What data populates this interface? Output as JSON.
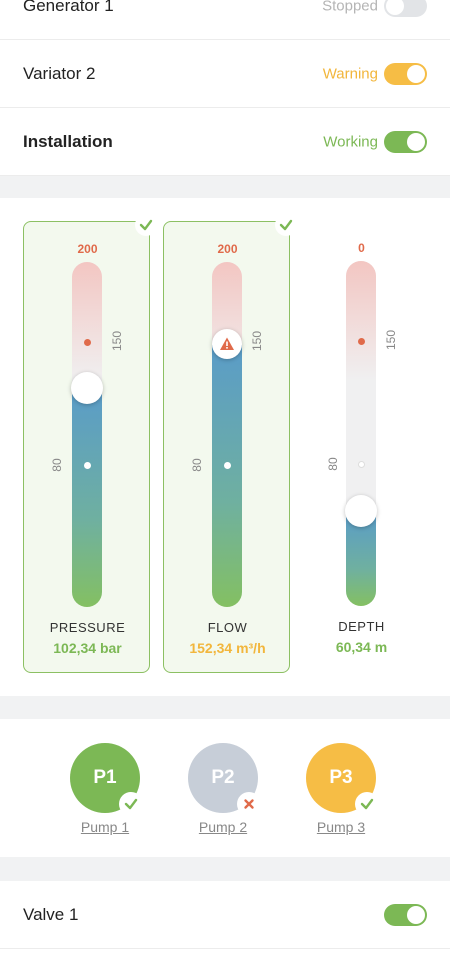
{
  "rows_top": [
    {
      "name": "Generator 1",
      "status": "Stopped",
      "status_color": "#b5b5b5",
      "toggle_on": false,
      "bold": false
    },
    {
      "name": "Variator 2",
      "status": "Warning",
      "status_color": "#f2b63c",
      "toggle_on": true,
      "toggle_color": "#f6bd45",
      "bold": false
    },
    {
      "name": "Installation",
      "status": "Working",
      "status_color": "#7cb855",
      "toggle_on": true,
      "toggle_color": "#7cb855",
      "bold": true
    }
  ],
  "gauges": [
    {
      "name": "PRESSURE",
      "value": "102,34 bar",
      "value_color": "#7cb855",
      "top": "200",
      "mid": "150",
      "low": "80",
      "level_pct": 63,
      "active": true,
      "marker": "knob"
    },
    {
      "name": "FLOW",
      "value": "152,34 m³/h",
      "value_color": "#f2b63c",
      "top": "200",
      "mid": "150",
      "low": "80",
      "level_pct": 76,
      "active": true,
      "marker": "warning"
    },
    {
      "name": "DEPTH",
      "value": "60,34 m",
      "value_color": "#7cb855",
      "top": "0",
      "mid": "150",
      "low": "80",
      "level_pct": 27,
      "active": false,
      "marker": "knob"
    }
  ],
  "pumps": [
    {
      "id": "P1",
      "label": "Pump 1",
      "color": "#7cb855",
      "state": "ok"
    },
    {
      "id": "P2",
      "label": "Pump 2",
      "color": "#c7ced8",
      "state": "error"
    },
    {
      "id": "P3",
      "label": "Pump 3",
      "color": "#f6bd45",
      "state": "ok"
    }
  ],
  "valve": {
    "name": "Valve 1",
    "toggle_on": true,
    "toggle_color": "#7cb855"
  }
}
